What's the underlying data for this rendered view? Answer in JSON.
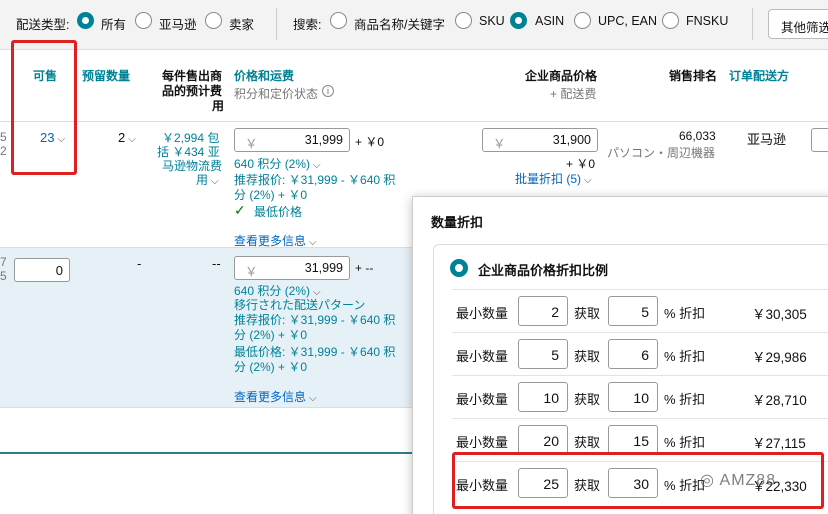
{
  "filter": {
    "type_label": "配送类型:",
    "type_options": [
      "所有",
      "亚马逊",
      "卖家"
    ],
    "search_label": "搜索:",
    "search_options": [
      "商品名称/关键字",
      "SKU",
      "ASIN",
      "UPC, EAN",
      "FNSKU"
    ],
    "more_button": "其他筛选"
  },
  "header": {
    "available": "可售",
    "reserved": "预留数量",
    "fee_line1": "每件售出商",
    "fee_line2": "品的预计费",
    "fee_line3": "用",
    "price": "价格和运费",
    "price_sub": "积分和定价状态",
    "biz_price": "企业商品价格",
    "biz_sub": "+ 配送费",
    "rank": "销售排名",
    "fulfill": "订单配送方"
  },
  "row1": {
    "edge_a": "5",
    "edge_b": "2",
    "available": "23",
    "reserved": "2",
    "fee1": "￥2,994 包",
    "fee2": "括 ￥434 亚",
    "fee3": "马逊物流费",
    "fee4": "用",
    "price_value": "31,999",
    "shipping": "+ ￥0",
    "points": "640 积分 (2%)",
    "recommend1": "推荐报价: ￥31,999 - ￥640 积",
    "recommend2": "分 (2%) + ￥0",
    "lowest": "最低价格",
    "more": "查看更多信息",
    "biz_value": "31,900",
    "biz_ship": "+ ￥0",
    "tiered": "批量折扣 (5)",
    "rank_value": "66,033",
    "rank_cat": "パソコン・周辺機器",
    "fulfill_value": "亚马逊"
  },
  "row2": {
    "edge_a": "7",
    "edge_b": "5",
    "available": "0",
    "reserved": "-",
    "fee": "--",
    "price_value": "31,999",
    "shipping": "+ --",
    "points": "640 积分 (2%)",
    "note": "移行された配送パターン",
    "recommend1": "推荐报价: ￥31,999 - ￥640 积",
    "recommend2": "分 (2%) + ￥0",
    "lowest1": "最低价格: ￥31,999 - ￥640 积",
    "lowest2": "分 (2%) + ￥0",
    "more": "查看更多信息"
  },
  "popover": {
    "title": "数量折扣",
    "option": "企业商品价格折扣比例",
    "qty_label": "最小数量",
    "get_label": "获取",
    "pct_label": "% 折扣",
    "tiers": [
      {
        "qty": "2",
        "pct": "5",
        "price": "￥30,305"
      },
      {
        "qty": "5",
        "pct": "6",
        "price": "￥29,986"
      },
      {
        "qty": "10",
        "pct": "10",
        "price": "￥28,710"
      },
      {
        "qty": "20",
        "pct": "15",
        "price": "￥27,115"
      },
      {
        "qty": "25",
        "pct": "30",
        "price": "￥22,330"
      }
    ]
  },
  "currency_symbol": "￥",
  "watermark": "AMZ88"
}
